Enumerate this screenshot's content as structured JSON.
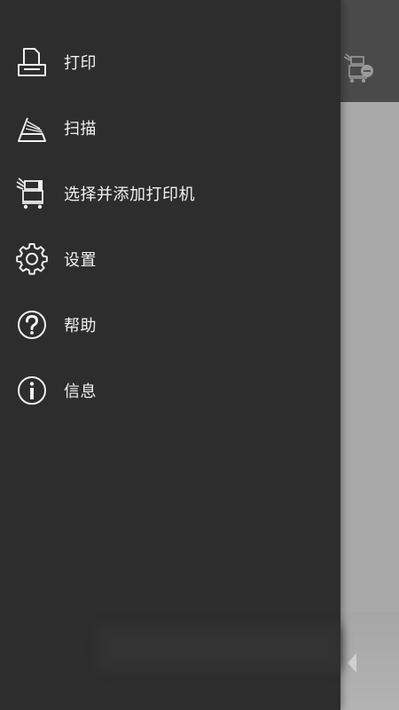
{
  "drawer": {
    "items": [
      {
        "label": "打印",
        "icon": "print-icon"
      },
      {
        "label": "扫描",
        "icon": "scan-icon"
      },
      {
        "label": "选择并添加打印机",
        "icon": "add-printer-icon"
      },
      {
        "label": "设置",
        "icon": "settings-icon"
      },
      {
        "label": "帮助",
        "icon": "help-icon"
      },
      {
        "label": "信息",
        "icon": "info-icon"
      }
    ]
  },
  "app": {
    "toolbar_icon": "printer-status-icon",
    "back_icon": "back-chevron-icon"
  },
  "colors": {
    "drawer_background": "#2d2d2d",
    "scrim": "#a9a9a9",
    "toolbar": "#4a4a4a",
    "text": "#f2f2f2"
  }
}
